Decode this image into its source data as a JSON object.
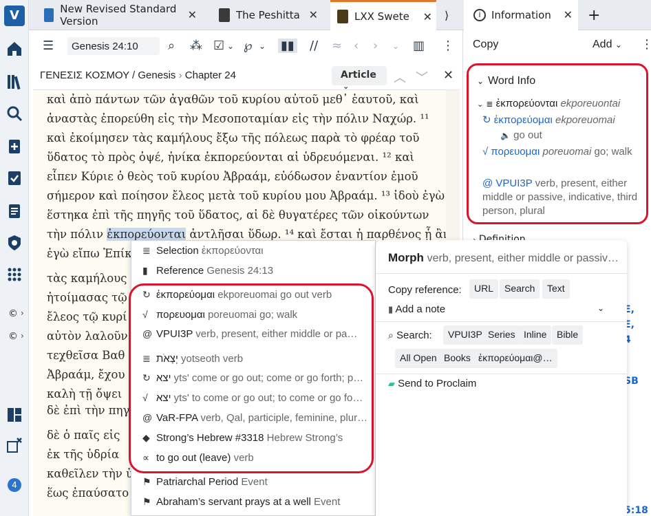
{
  "tabs": [
    {
      "label": "New Revised Standard Version",
      "color": "#2a6fb5"
    },
    {
      "label": "The Peshitta",
      "color": "#3a3a3a"
    },
    {
      "label": "LXX Swete",
      "color": "#4b3a1a"
    }
  ],
  "info_tab": {
    "label": "Information"
  },
  "toolbar": {
    "reference": "Genesis 24:10"
  },
  "breadcrumb": {
    "text": "ΓΕΝΕΣΙΣ ΚΟΣΜΟΥ / Genesis",
    "chapter": "Chapter 24",
    "article_label": "Article"
  },
  "reader": {
    "lines": [
      "καὶ ἀπὸ πάντων τῶν ἀγαθῶν τοῦ κυρίου αὐτοῦ μεθ᾽ ἑαυτοῦ, καὶ",
      "ἀναστὰς ἐπορεύθη εἰς τὴν Μεσοποταμίαν εἰς τὴν πόλιν Ναχώρ. ¹¹",
      "καὶ ἐκοίμησεν τὰς καμήλους ἔξω τῆς πόλεως παρὰ τὸ φρέαρ τοῦ",
      "ὕδατος τὸ πρὸς ὀψέ, ἡνίκα ἐκπορεύονται αἱ ὑδρευόμεναι. ¹² καὶ",
      "εἶπεν Κύριε ὁ θεὸς τοῦ κυρίου Ἀβραάμ, εὐόδωσον ἐναντίον ἐμοῦ",
      "σήμερον καὶ ποίησον ἔλεος μετὰ τοῦ κυρίου μου Ἀβραάμ. ¹³ ἰδοὺ ἐγὼ",
      "ἕστηκα ἐπὶ τῆς πηγῆς τοῦ ὕδατος, αἱ δὲ θυγατέρες τῶν οἰκούντων"
    ],
    "line8_pre": "τὴν πόλιν ",
    "line8_hl": "ἐκπορεύονται",
    "line8_post": " ἀντλῆσαι ὕδωρ. ¹⁴ καὶ ἔσται ἡ παρθένος ᾗ ἂν",
    "partial_lines": [
      "ἐγὼ εἴπω Ἐπίκ",
      "τὰς καμήλους",
      "ἡτοίμασας τῷ",
      "ἔλεος τῷ κυρί",
      "αὐτὸν λαλοῦν",
      "τεχθεῖσα Βαθ",
      "Ἀβραάμ, ἔχου",
      "καλὴ τῇ ὄψει",
      "δὲ ἐπὶ τὴν πηγ",
      "δὲ ὁ παῖς εἰς",
      "ἐκ τῆς ὑδρία",
      "καθεῖλεν τὴν ὑ",
      "ἕως ἐπαύσατο"
    ]
  },
  "info_panel": {
    "copy": "Copy",
    "add": "Add",
    "word_info_title": "Word Info",
    "surface": "ἐκπορεύονται",
    "surface_translit": "ekporeuontai",
    "lemma": "ἐκπορεύομαι",
    "lemma_translit": "ekporeuomai",
    "lemma_gloss": "go out",
    "root": "πορευομαι",
    "root_translit": "poreuomai",
    "root_gloss": "go; walk",
    "morph_code": "VPUI3P",
    "morph_desc": "verb, present, either middle or passive, indicative, third person, plural",
    "definition": "Definition",
    "partial_right": [
      "E,",
      "E,",
      "4",
      ",",
      "SB",
      "5:18"
    ]
  },
  "context_menu": {
    "items": [
      {
        "icon": "text-icon",
        "label": "Selection",
        "secondary": "ἐκπορεύονται"
      },
      {
        "icon": "bookmark-icon",
        "label": "Reference",
        "secondary": "Genesis 24:13"
      },
      {
        "icon": "lemma-icon",
        "label": "ἐκπορεύομαι",
        "secondary": "ekporeuomai go out verb"
      },
      {
        "icon": "root-icon",
        "label": "πορευομαι",
        "secondary": "poreuomai go; walk"
      },
      {
        "icon": "morph-icon",
        "label": "VPUI3P",
        "secondary": "verb, present, either middle or pa…"
      },
      {
        "icon": "text-icon",
        "label": "יְצָאֹת",
        "secondary": "yotseoth verb"
      },
      {
        "icon": "lemma-icon",
        "label": "יצא",
        "secondary": "yts' come or go out; come or go forth; p…"
      },
      {
        "icon": "root-icon",
        "label": "יצא",
        "secondary": "yts' to come or go out; to come or go fo…"
      },
      {
        "icon": "morph-icon",
        "label": "VaR-FPA",
        "secondary": "verb, Qal, participle, feminine, plur…"
      },
      {
        "icon": "diamond-icon",
        "label": "Strong’s Hebrew #3318",
        "secondary": "Hebrew Strong’s"
      },
      {
        "icon": "sense-icon",
        "label": "to go out (leave)",
        "secondary": "verb"
      },
      {
        "icon": "flag-icon",
        "label": "Patriarchal Period",
        "secondary": "Event"
      },
      {
        "icon": "flag-icon",
        "label": "Abraham’s servant prays at a well",
        "secondary": "Event"
      }
    ]
  },
  "morph_panel": {
    "title": "Morph",
    "title_desc": "verb, present, either middle or passiv…",
    "copy_reference": "Copy reference:",
    "copy_chips": [
      "URL",
      "Search",
      "Text"
    ],
    "add_note": "Add a note",
    "search_label": "Search:",
    "search_chips": [
      "VPUI3P",
      "Series",
      "Inline",
      "Bible"
    ],
    "search_chips2": [
      "All Open",
      "Books",
      "ἐκπορεύομαι@…"
    ],
    "send": "Send to Proclaim"
  },
  "appbar": {
    "badge": "4"
  }
}
